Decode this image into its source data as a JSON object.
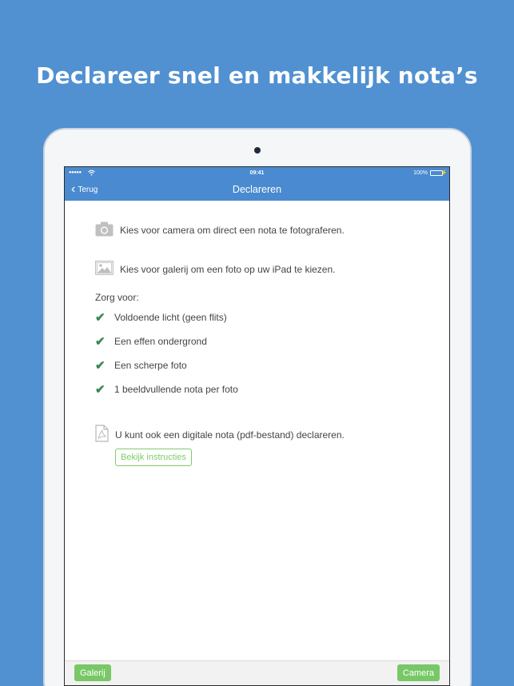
{
  "headline": "Declareer snel en makkelijk nota’s",
  "statusbar": {
    "signal": "●●●●●",
    "time": "09:41",
    "battery": "100%"
  },
  "navbar": {
    "back_label": "Terug",
    "title": "Declareren"
  },
  "content": {
    "camera_text": "Kies voor camera om direct een nota te fotograferen.",
    "gallery_text": "Kies voor galerij om een foto op uw iPad te kiezen.",
    "zorg_label": "Zorg voor:",
    "checklist": [
      "Voldoende licht (geen flits)",
      "Een effen ondergrond",
      "Een scherpe foto",
      "1 beeldvullende nota per foto"
    ],
    "pdf_text": "U kunt ook een digitale nota (pdf-bestand) declareren.",
    "instructions_button": "Bekijk instructies"
  },
  "toolbar": {
    "gallery_button": "Galerij",
    "camera_button": "Camera"
  },
  "colors": {
    "background": "#5191d1",
    "navbar": "#4a8ad0",
    "check": "#3b8650",
    "button_green": "#78c868"
  },
  "icons": {
    "camera": "camera-icon",
    "gallery": "image-icon",
    "check": "checkmark-icon",
    "pdf": "pdf-document-icon"
  }
}
